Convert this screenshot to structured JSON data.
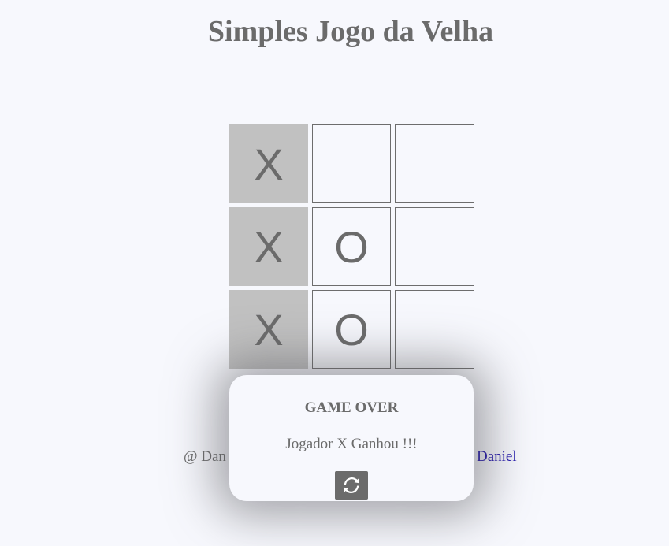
{
  "page": {
    "title": "Simples Jogo da Velha"
  },
  "board": {
    "cells": [
      {
        "mark": "X",
        "winning": true
      },
      {
        "mark": "",
        "winning": false
      },
      {
        "mark": "",
        "winning": false
      },
      {
        "mark": "X",
        "winning": true
      },
      {
        "mark": "O",
        "winning": false
      },
      {
        "mark": "",
        "winning": false
      },
      {
        "mark": "X",
        "winning": true
      },
      {
        "mark": "O",
        "winning": false
      },
      {
        "mark": "",
        "winning": false
      }
    ]
  },
  "footer": {
    "credit_prefix": "@ Dan",
    "author_link": "Daniel"
  },
  "modal": {
    "title": "GAME OVER",
    "message": "Jogador X Ganhou !!!",
    "restart_icon": "refresh-icon"
  },
  "colors": {
    "background": "#f7f8fd",
    "text": "#6b6b6b",
    "winning_cell": "#c1c1c1",
    "button": "#6b6b6b",
    "link": "#1a0dab"
  }
}
